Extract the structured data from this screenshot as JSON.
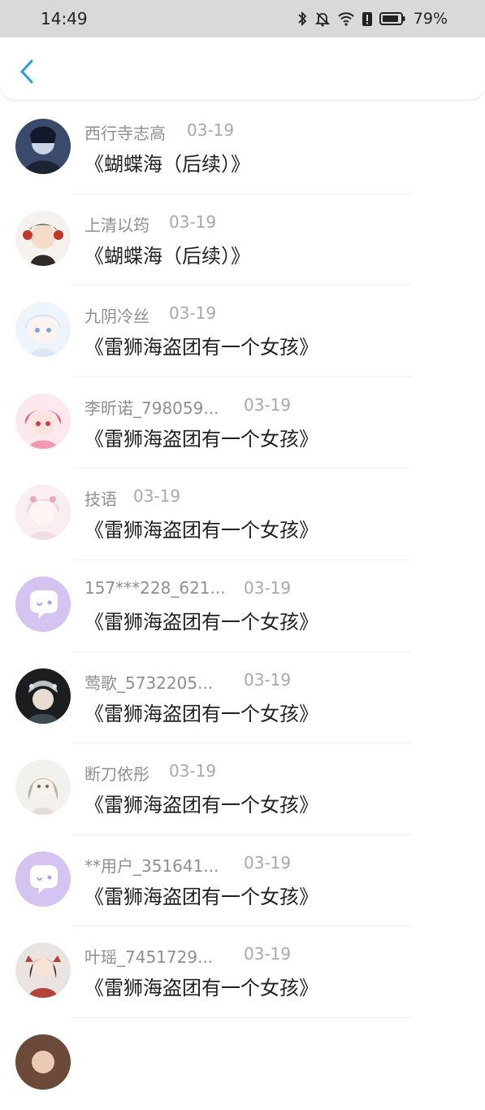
{
  "status_bar": {
    "time": "14:49",
    "battery": "79%",
    "icons": [
      "bluetooth-icon",
      "bell-off-icon",
      "wifi-icon",
      "alert-icon",
      "battery-icon"
    ]
  },
  "header": {
    "back_icon": "chevron-left-icon",
    "accent": "#2e9be6"
  },
  "list": [
    {
      "user": "西行寺志高",
      "date": "03-19",
      "message": "《蝴蝶海（后续）》",
      "avatar": "portrait-dark"
    },
    {
      "user": "上清以筠",
      "date": "03-19",
      "message": "《蝴蝶海（后续）》",
      "avatar": "portrait-anime"
    },
    {
      "user": "九阴冷丝",
      "date": "03-19",
      "message": "《雷狮海盗团有一个女孩》",
      "avatar": "portrait-light"
    },
    {
      "user": "李昕诺_798059...",
      "date": "03-19",
      "message": "《雷狮海盗团有一个女孩》",
      "avatar": "portrait-pink"
    },
    {
      "user": "技语",
      "date": "03-19",
      "message": "《雷狮海盗团有一个女孩》",
      "avatar": "portrait-pale"
    },
    {
      "user": "157***228_621...",
      "date": "03-19",
      "message": "《雷狮海盗团有一个女孩》",
      "avatar": "default-chat"
    },
    {
      "user": "莺歌_5732205...",
      "date": "03-19",
      "message": "《雷狮海盗团有一个女孩》",
      "avatar": "portrait-black"
    },
    {
      "user": "断刀依彤",
      "date": "03-19",
      "message": "《雷狮海盗团有一个女孩》",
      "avatar": "portrait-sketch"
    },
    {
      "user": "**用户_351641...",
      "date": "03-19",
      "message": "《雷狮海盗团有一个女孩》",
      "avatar": "default-chat"
    },
    {
      "user": "叶瑶_7451729...",
      "date": "03-19",
      "message": "《雷狮海盗团有一个女孩》",
      "avatar": "portrait-red"
    },
    {
      "user": "",
      "date": "",
      "message": "",
      "avatar": "portrait-partial"
    }
  ]
}
